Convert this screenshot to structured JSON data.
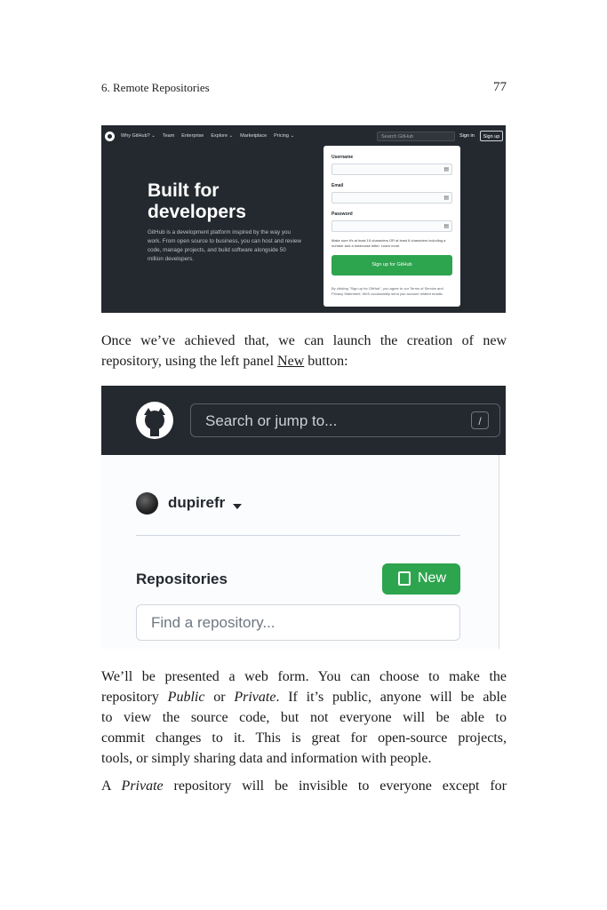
{
  "header": {
    "chapter": "6. Remote Repositories",
    "page_number": "77"
  },
  "shot1": {
    "nav": [
      "Why GitHub? ⌄",
      "Team",
      "Enterprise",
      "Explore ⌄",
      "Marketplace",
      "Pricing ⌄"
    ],
    "search_placeholder": "Search GitHub",
    "signin": "Sign in",
    "signup": "Sign up",
    "hero_title": "Built for developers",
    "hero_sub": "GitHub is a development platform inspired by the way you work. From open source to business, you can host and review code, manage projects, and build software alongside 50 million developers.",
    "form": {
      "username_label": "Username",
      "email_label": "Email",
      "password_label": "Password",
      "password_note": "Make sure it's at least 15 characters OR at least 8 characters including a number and a lowercase letter. Learn more.",
      "button": "Sign up for GitHub",
      "terms": "By clicking \"Sign up for GitHub\", you agree to our Terms of Service and Privacy Statement. We'll occasionally send you account related emails."
    }
  },
  "para1": {
    "line1": "Once we’ve achieved that, we can launch the creation of new",
    "line2_before": "repository, using the left panel ",
    "line2_link": "New",
    "line2_after": " button:"
  },
  "shot2": {
    "search_placeholder": "Search or jump to...",
    "slash_key": "/",
    "username": "dupirefr",
    "repositories_title": "Repositories",
    "new_button": "New",
    "find_placeholder": "Find a repository..."
  },
  "para2": {
    "l1": "We’ll be presented a web form. You can choose to make the",
    "l2a": "repository ",
    "l2b": "Public",
    "l2c": " or ",
    "l2d": "Private",
    "l2e": ". If it’s public, anyone will be able",
    "l3": "to view the source code, but not everyone will be able to",
    "l4": "commit changes to it. This is great for open-source projects,",
    "l5": "tools, or simply sharing data and information with people."
  },
  "para3": {
    "a": "A ",
    "b": "Private",
    "c": " repository will be invisible to everyone except for"
  }
}
